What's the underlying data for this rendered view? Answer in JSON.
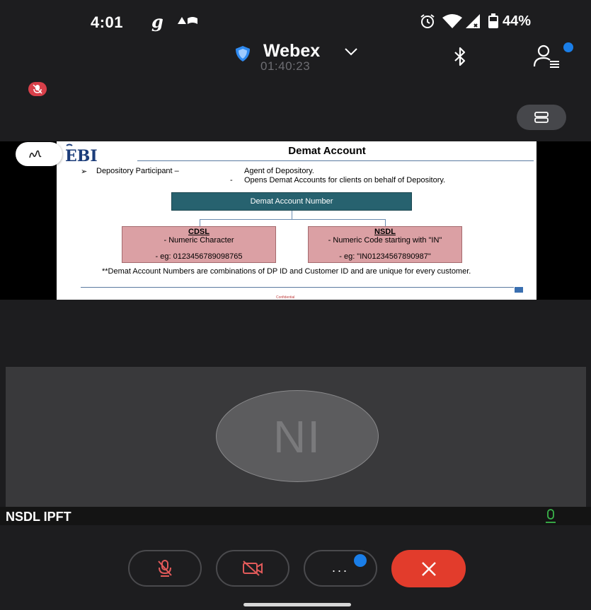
{
  "status_bar": {
    "time": "4:01",
    "g_indicator": "g",
    "battery_text": "44%",
    "icons": [
      "notification-icon",
      "alarm-icon",
      "wifi-icon",
      "signal-icon",
      "battery-icon"
    ]
  },
  "header": {
    "app_name": "Webex",
    "elapsed_time": "01:40:23",
    "icons": [
      "shield-icon",
      "chevron-down-icon",
      "bluetooth-icon",
      "participants-icon",
      "layout-icon",
      "mic-muted-icon"
    ]
  },
  "shared_slide": {
    "title": "Demat Account",
    "bullet_marker": "➢",
    "term": "Depository Participant –",
    "definition_1": "Agent of Depository.",
    "definition_2_dash": "-",
    "definition_2": "Opens Demat Accounts for clients on behalf of Depository.",
    "center_box": "Demat Account Number",
    "cdsl": {
      "name": "CDSL",
      "description": "- Numeric Character",
      "example": "- eg: 0123456789098765"
    },
    "nsdl": {
      "name": "NSDL",
      "description": "- Numeric Code starting with \"IN\"",
      "example": "- eg: \"IN01234567890987\""
    },
    "footnote": "**Demat Account Numbers are combinations of DP ID and Customer ID and are unique for every customer.",
    "confidential_text": "Confidential"
  },
  "participant": {
    "initials": "NI",
    "name": "NSDL IPFT"
  },
  "controls": {
    "more_label": "...",
    "icons": [
      "mic-off-icon",
      "video-off-icon",
      "more-icon",
      "end-call-icon"
    ]
  },
  "colors": {
    "accent_blue": "#1a7ee8",
    "end_call_red": "#e23c2c",
    "muted_badge": "#d8404a",
    "slide_header_box": "#27626f",
    "slide_box_pink": "#dba0a4",
    "audio_green": "#3ab54a"
  }
}
